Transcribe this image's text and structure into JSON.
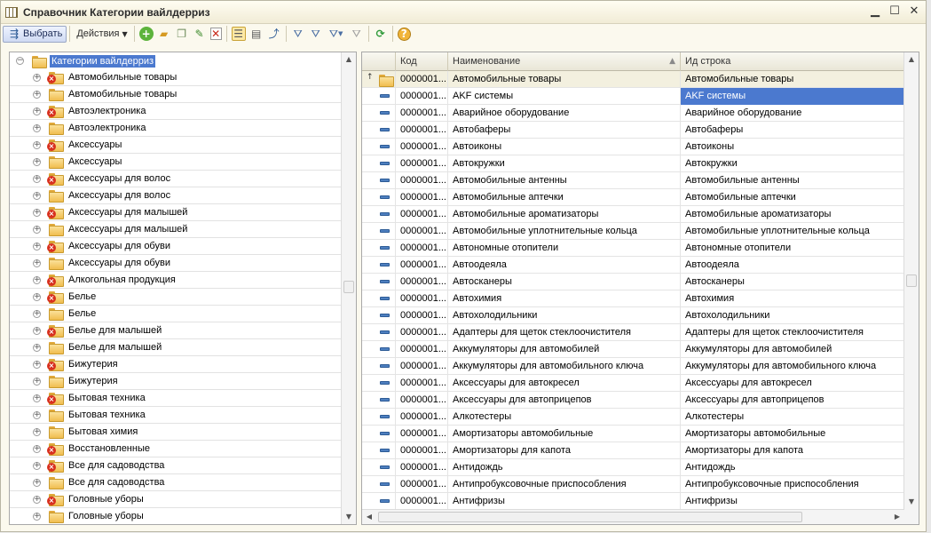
{
  "window": {
    "title": "Справочник Категории вайлдерриз"
  },
  "toolbar": {
    "select_label": "Выбрать",
    "actions_label": "Действия",
    "icons": [
      "add-icon",
      "add-group-icon",
      "copy-icon",
      "edit-icon",
      "delete-mark-icon",
      "hierarchy-view-icon",
      "list-view-icon",
      "level-up-icon",
      "filter-icon",
      "filter-by-value-icon",
      "filter-history-icon",
      "clear-filter-icon",
      "refresh-icon",
      "help-icon"
    ]
  },
  "tree": {
    "root_label": "Категории вайлдерриз",
    "items": [
      {
        "label": "Автомобильные товары",
        "deleted": true
      },
      {
        "label": "Автомобильные товары",
        "deleted": false
      },
      {
        "label": "Автоэлектроника",
        "deleted": true
      },
      {
        "label": "Автоэлектроника",
        "deleted": false
      },
      {
        "label": "Аксессуары",
        "deleted": true
      },
      {
        "label": "Аксессуары",
        "deleted": false
      },
      {
        "label": "Аксессуары для волос",
        "deleted": true
      },
      {
        "label": "Аксессуары для волос",
        "deleted": false
      },
      {
        "label": "Аксессуары для малышей",
        "deleted": true
      },
      {
        "label": "Аксессуары для малышей",
        "deleted": false
      },
      {
        "label": "Аксессуары для обуви",
        "deleted": true
      },
      {
        "label": "Аксессуары для обуви",
        "deleted": false
      },
      {
        "label": "Алкогольная продукция",
        "deleted": true
      },
      {
        "label": "Белье",
        "deleted": true
      },
      {
        "label": "Белье",
        "deleted": false
      },
      {
        "label": "Белье для малышей",
        "deleted": true
      },
      {
        "label": "Белье для малышей",
        "deleted": false
      },
      {
        "label": "Бижутерия",
        "deleted": true
      },
      {
        "label": "Бижутерия",
        "deleted": false
      },
      {
        "label": "Бытовая техника",
        "deleted": true
      },
      {
        "label": "Бытовая техника",
        "deleted": false
      },
      {
        "label": "Бытовая химия",
        "deleted": false
      },
      {
        "label": "Восстановленные",
        "deleted": true
      },
      {
        "label": "Все для садоводства",
        "deleted": true
      },
      {
        "label": "Все для садоводства",
        "deleted": false
      },
      {
        "label": "Головные уборы",
        "deleted": true
      },
      {
        "label": "Головные уборы",
        "deleted": false
      }
    ]
  },
  "grid": {
    "columns": {
      "code": "Код",
      "name": "Наименование",
      "id_string": "Ид строка"
    },
    "parent_row": {
      "code": "0000001...",
      "name": "Автомобильные товары",
      "id_string": "Автомобильные товары"
    },
    "rows": [
      {
        "code": "0000001...",
        "name": "AKF системы",
        "id_string": "AKF системы"
      },
      {
        "code": "0000001...",
        "name": "Аварийное оборудование",
        "id_string": "Аварийное оборудование"
      },
      {
        "code": "0000001...",
        "name": "Автобаферы",
        "id_string": "Автобаферы"
      },
      {
        "code": "0000001...",
        "name": "Автоиконы",
        "id_string": "Автоиконы"
      },
      {
        "code": "0000001...",
        "name": "Автокружки",
        "id_string": "Автокружки"
      },
      {
        "code": "0000001...",
        "name": "Автомобильные антенны",
        "id_string": "Автомобильные антенны"
      },
      {
        "code": "0000001...",
        "name": "Автомобильные аптечки",
        "id_string": "Автомобильные аптечки"
      },
      {
        "code": "0000001...",
        "name": "Автомобильные ароматизаторы",
        "id_string": "Автомобильные ароматизаторы"
      },
      {
        "code": "0000001...",
        "name": "Автомобильные уплотнительные кольца",
        "id_string": "Автомобильные уплотнительные кольца"
      },
      {
        "code": "0000001...",
        "name": "Автономные отопители",
        "id_string": "Автономные отопители"
      },
      {
        "code": "0000001...",
        "name": "Автоодеяла",
        "id_string": "Автоодеяла"
      },
      {
        "code": "0000001...",
        "name": "Автосканеры",
        "id_string": "Автосканеры"
      },
      {
        "code": "0000001...",
        "name": "Автохимия",
        "id_string": "Автохимия"
      },
      {
        "code": "0000001...",
        "name": "Автохолодильники",
        "id_string": "Автохолодильники"
      },
      {
        "code": "0000001...",
        "name": "Адаптеры для щеток стеклоочистителя",
        "id_string": "Адаптеры для щеток стеклоочистителя"
      },
      {
        "code": "0000001...",
        "name": "Аккумуляторы для автомобилей",
        "id_string": "Аккумуляторы для автомобилей"
      },
      {
        "code": "0000001...",
        "name": "Аккумуляторы для автомобильного ключа",
        "id_string": "Аккумуляторы для автомобильного ключа"
      },
      {
        "code": "0000001...",
        "name": "Аксессуары для автокресел",
        "id_string": "Аксессуары для автокресел"
      },
      {
        "code": "0000001...",
        "name": "Аксессуары для автоприцепов",
        "id_string": "Аксессуары для автоприцепов"
      },
      {
        "code": "0000001...",
        "name": "Алкотестеры",
        "id_string": "Алкотестеры"
      },
      {
        "code": "0000001...",
        "name": "Амортизаторы автомобильные",
        "id_string": "Амортизаторы автомобильные"
      },
      {
        "code": "0000001...",
        "name": "Амортизаторы для капота",
        "id_string": "Амортизаторы для капота"
      },
      {
        "code": "0000001...",
        "name": "Антидождь",
        "id_string": "Антидождь"
      },
      {
        "code": "0000001...",
        "name": "Антипробуксовочные приспособления",
        "id_string": "Антипробуксовочные приспособления"
      },
      {
        "code": "0000001...",
        "name": "Антифризы",
        "id_string": "Антифризы"
      }
    ]
  },
  "colors": {
    "selection": "#4b79cf",
    "window_bg": "#fbf9ee",
    "folder": "#f0bd4e",
    "deletion_mark": "#d8301e"
  }
}
